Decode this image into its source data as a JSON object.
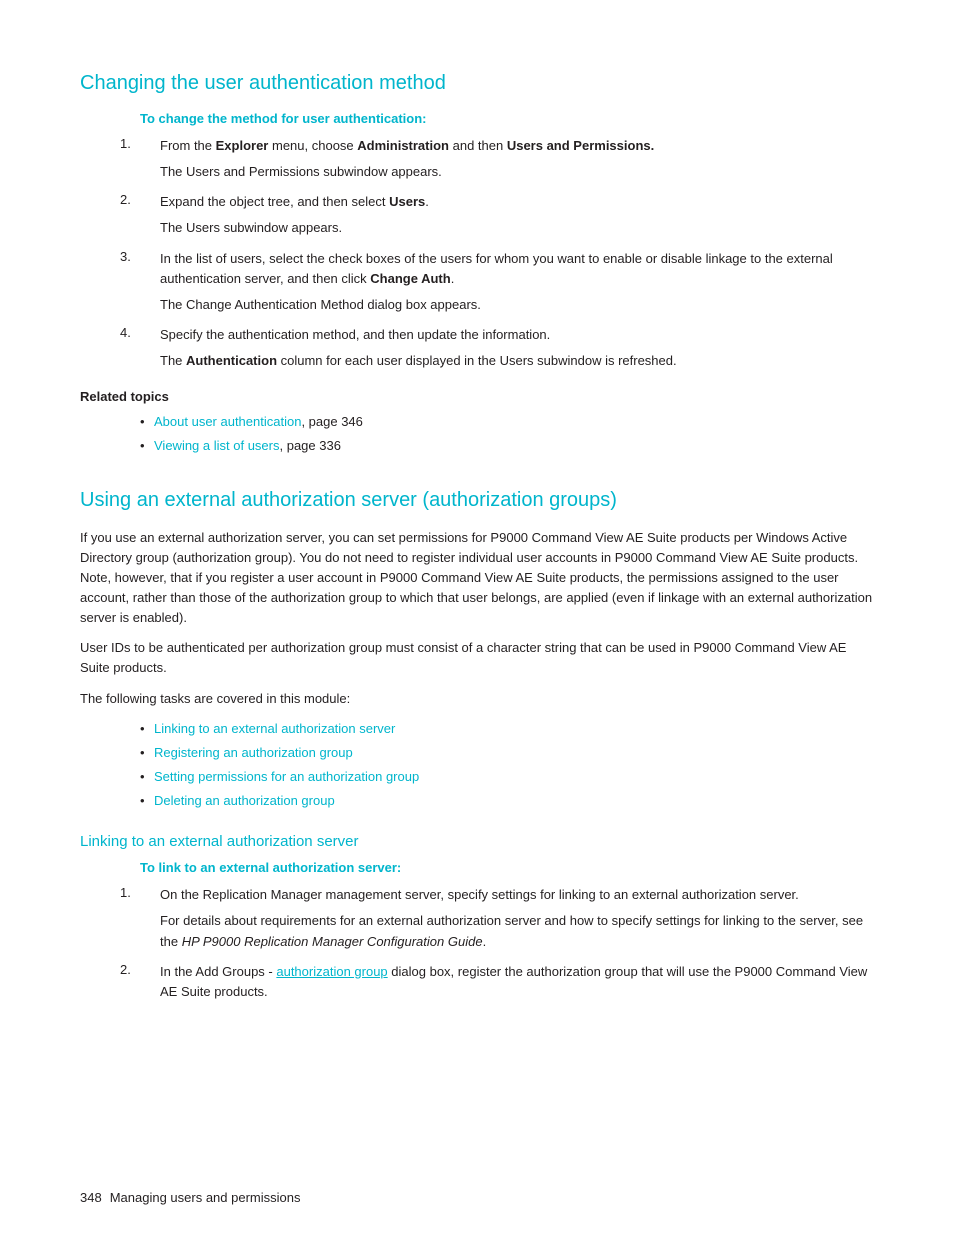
{
  "page": {
    "background": "#ffffff"
  },
  "section1": {
    "title": "Changing the user authentication method",
    "procedure_label": "To change the method for user authentication:",
    "steps": [
      {
        "num": "1.",
        "text": "From the ",
        "bold1": "Explorer",
        "text2": " menu, choose ",
        "bold2": "Administration",
        "text3": " and then ",
        "bold3": "Users and Permissions.",
        "sub": "The Users and Permissions subwindow appears."
      },
      {
        "num": "2.",
        "text": "Expand the object tree, and then select ",
        "bold1": "Users",
        "text2": ".",
        "sub": "The Users subwindow appears."
      },
      {
        "num": "3.",
        "text": "In the list of users, select the check boxes of the users for whom you want to enable or disable linkage to the external authentication server, and then click ",
        "bold1": "Change Auth",
        "text2": ".",
        "sub": "The Change Authentication Method dialog box appears."
      },
      {
        "num": "4.",
        "text": "Specify the authentication method, and then update the information.",
        "bold1": "",
        "text2": "",
        "sub": "The ",
        "sub_bold": "Authentication",
        "sub_text2": " column for each user displayed in the Users subwindow is refreshed."
      }
    ],
    "related_topics_title": "Related topics",
    "related_topics": [
      {
        "text": "About user authentication",
        "page": ", page 346"
      },
      {
        "text": "Viewing a list of users",
        "page": ", page 336"
      }
    ]
  },
  "section2": {
    "title": "Using an external authorization server (authorization groups)",
    "body1": "If you use an external authorization server, you can set permissions for P9000 Command View AE Suite products per Windows Active Directory group (authorization group). You do not need to register individual user accounts in P9000 Command View AE Suite products. Note, however, that if you register a user account in P9000 Command View AE Suite products, the permissions assigned to the user account, rather than those of the authorization group to which that user belongs, are applied (even if linkage with an external authorization server is enabled).",
    "body2": "User IDs to be authenticated per authorization group must consist of a character string that can be used in P9000 Command View AE Suite products.",
    "body3": "The following tasks are covered in this module:",
    "tasks": [
      {
        "text": "Linking to an external authorization server"
      },
      {
        "text": "Registering an authorization group"
      },
      {
        "text": "Setting permissions for an authorization group"
      },
      {
        "text": "Deleting an authorization group"
      }
    ],
    "subsection": {
      "title": "Linking to an external authorization server",
      "procedure_label": "To link to an external authorization server:",
      "steps": [
        {
          "num": "1.",
          "text": "On the Replication Manager management server, specify settings for linking to an external authorization server.",
          "sub": "For details about requirements for an external authorization server and how to specify settings for linking to the server, see the ",
          "sub_italic": "HP P9000 Replication Manager Configuration Guide",
          "sub_text2": "."
        },
        {
          "num": "2.",
          "text_pre": "In the Add Groups - ",
          "text_underline": "authorization group",
          "text_post": " dialog box, register the authorization group that will use the P9000 Command View AE Suite products.",
          "sub": ""
        }
      ]
    }
  },
  "footer": {
    "page_num": "348",
    "text": "Managing users and permissions"
  }
}
